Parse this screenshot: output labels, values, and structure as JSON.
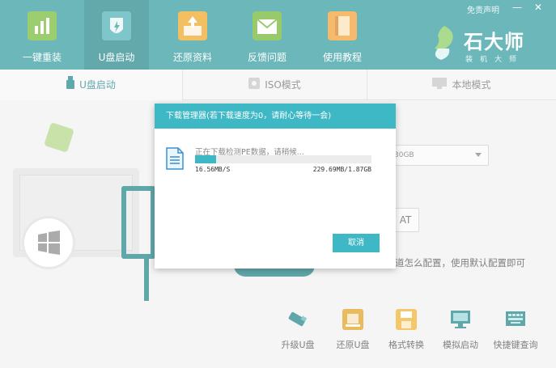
{
  "header": {
    "nav": [
      {
        "label": "一键重装",
        "icon": "chart-icon"
      },
      {
        "label": "U盘启动",
        "icon": "usb-shield-icon"
      },
      {
        "label": "还原资料",
        "icon": "restore-icon"
      },
      {
        "label": "反馈问题",
        "icon": "mail-icon"
      },
      {
        "label": "使用教程",
        "icon": "book-icon"
      }
    ],
    "disclaimer": "免责声明",
    "minimize": "—",
    "close": "✕",
    "brand": {
      "title": "石大师",
      "subtitle": "装机大师"
    }
  },
  "tabs": [
    {
      "label": "U盘启动",
      "active": true
    },
    {
      "label": "ISO模式",
      "active": false
    },
    {
      "label": "本地模式",
      "active": false
    }
  ],
  "background": {
    "select_value": "30GB",
    "format_label": "AT",
    "hint": "道怎么配置，使用默认配置即可"
  },
  "tools": [
    {
      "label": "升级U盘",
      "icon": "usb-upgrade-icon"
    },
    {
      "label": "还原U盘",
      "icon": "usb-restore-icon"
    },
    {
      "label": "格式转换",
      "icon": "floppy-icon"
    },
    {
      "label": "模拟启动",
      "icon": "monitor-icon"
    },
    {
      "label": "快捷键查询",
      "icon": "keyboard-icon"
    }
  ],
  "modal": {
    "title": "下载管理器(若下载速度为0，请耐心等待一会)",
    "status": "正在下载检测PE数据，请稍候...",
    "progress_fraction": 0.12,
    "speed": "16.56MB/S",
    "size": "229.69MB/1.87GB",
    "cancel": "取消"
  },
  "colors": {
    "header_bg": "#3a9fa3",
    "accent": "#3fb8c6",
    "dark_teal": "#2b8a8e"
  }
}
